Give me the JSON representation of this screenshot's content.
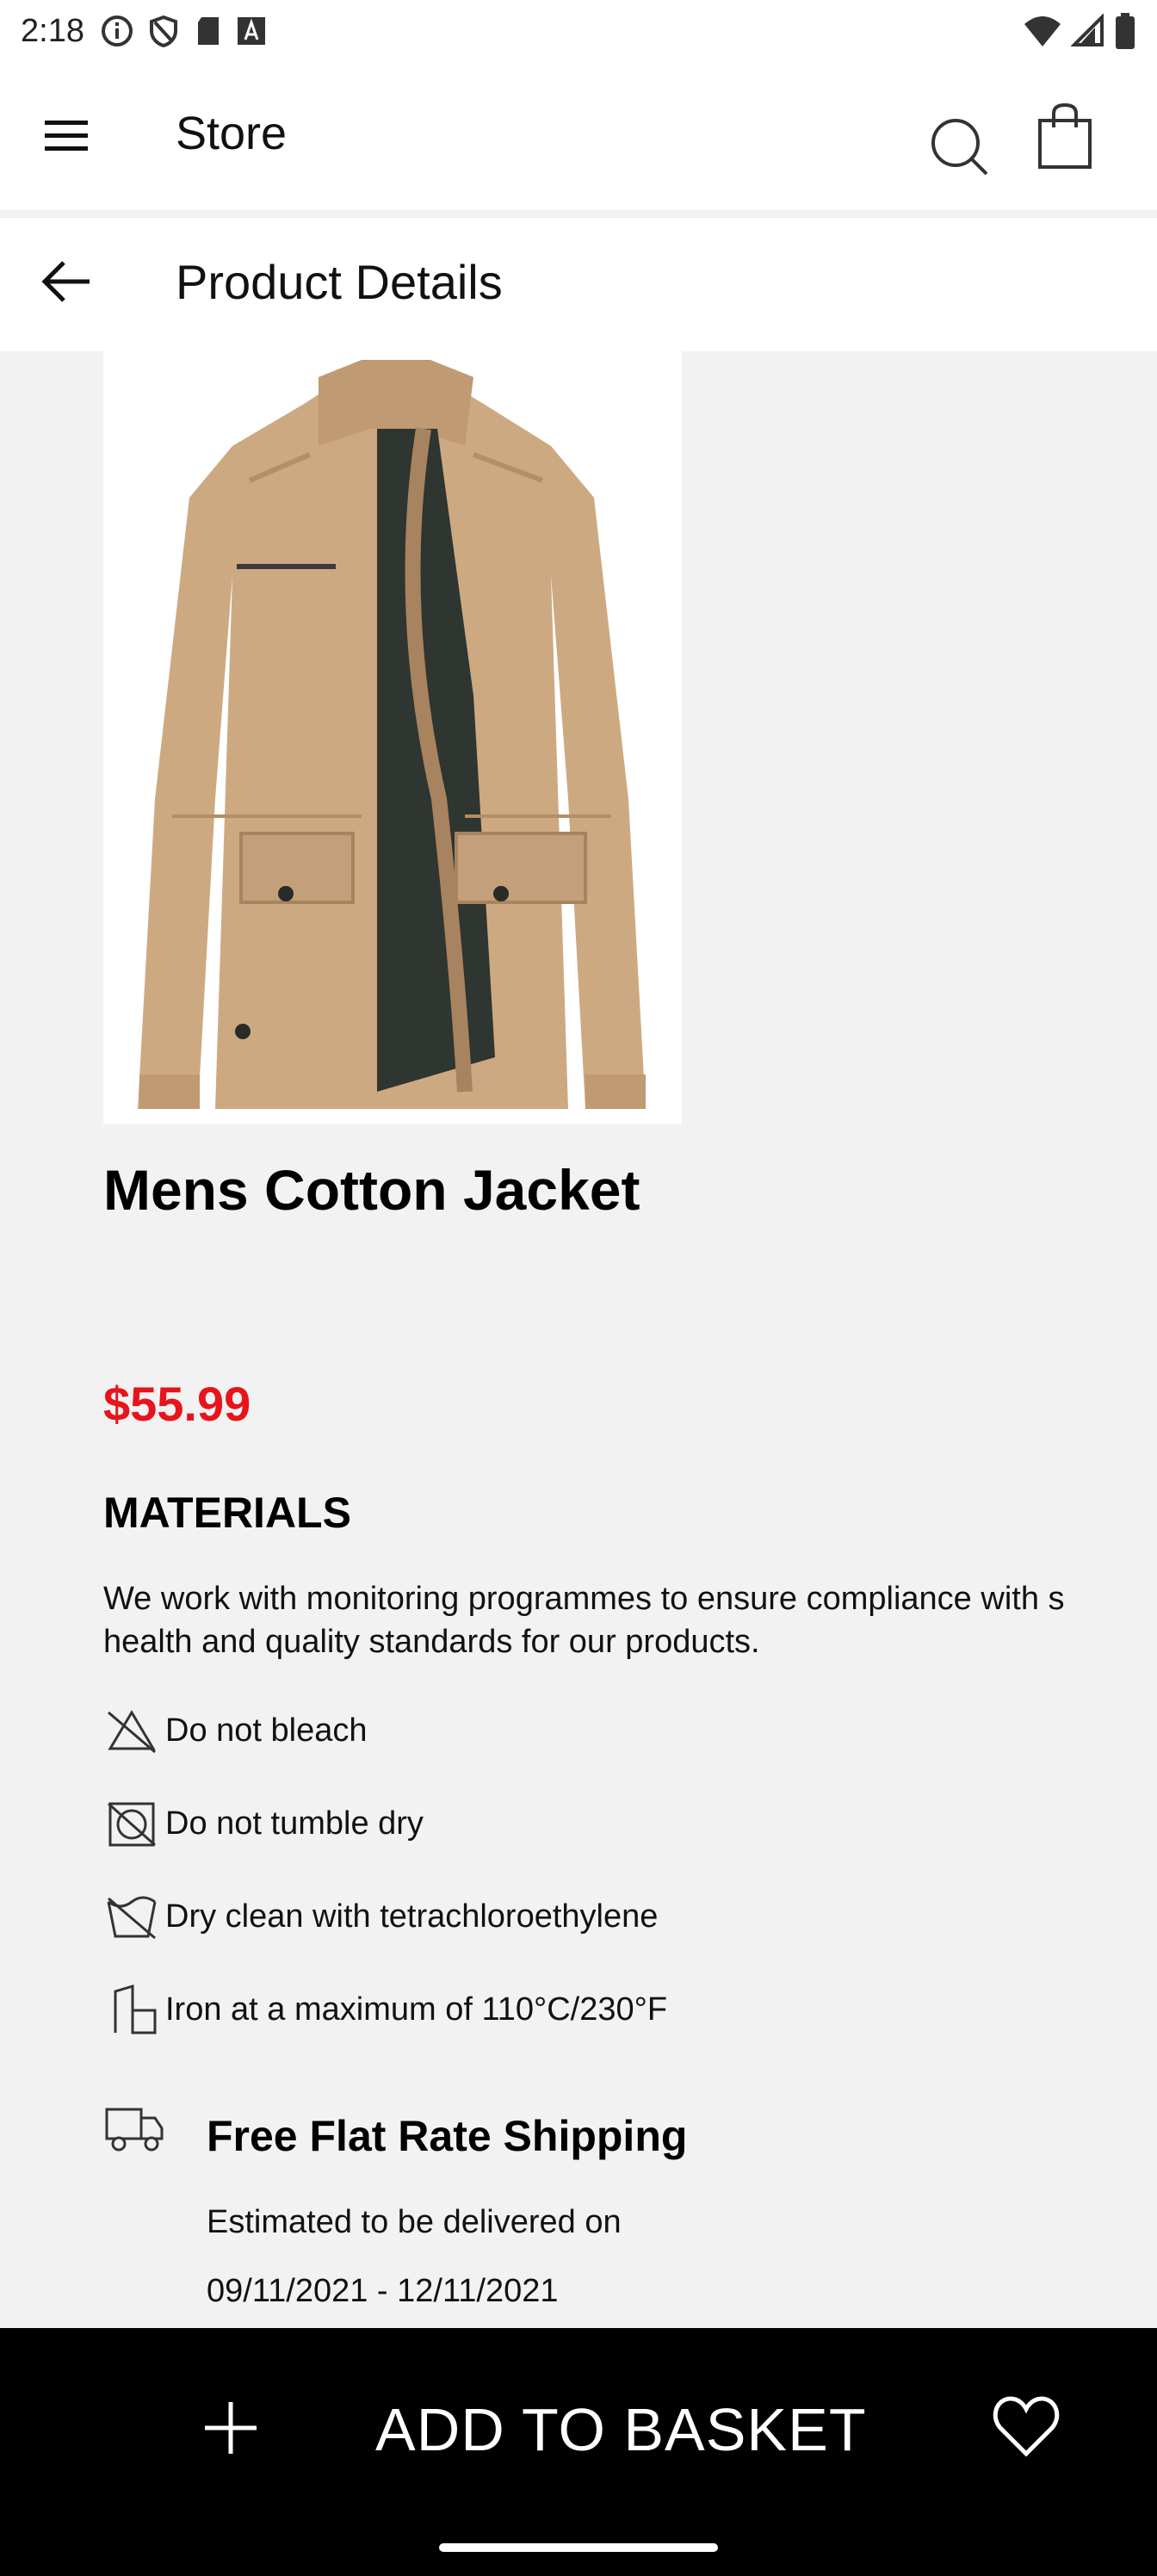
{
  "status_bar": {
    "time": "2:18"
  },
  "app_bar": {
    "title": "Store"
  },
  "sub_bar": {
    "title": "Product Details"
  },
  "product": {
    "name": "Mens Cotton Jacket",
    "price": "$55.99",
    "image_alt": "Khaki cotton jacket"
  },
  "materials": {
    "heading": "MATERIALS",
    "line1": "We work with monitoring programmes to ensure compliance with s",
    "line2": "health and quality standards for our products."
  },
  "care": [
    {
      "icon": "no-bleach-icon",
      "label": "Do not bleach"
    },
    {
      "icon": "no-tumble-dry-icon",
      "label": "Do not tumble dry"
    },
    {
      "icon": "dry-clean-icon",
      "label": "Dry clean with tetrachloroethylene"
    },
    {
      "icon": "iron-icon",
      "label": "Iron at a maximum of 110°C/230°F"
    }
  ],
  "shipping": {
    "title": "Free Flat Rate Shipping",
    "estimate": "Estimated to be delivered on",
    "dates": "09/11/2021 - 12/11/2021"
  },
  "bottom_bar": {
    "add_label": "ADD TO BASKET"
  },
  "colors": {
    "price": "#e8131b",
    "bottom_bar": "#000000",
    "background": "#f2f2f2"
  }
}
